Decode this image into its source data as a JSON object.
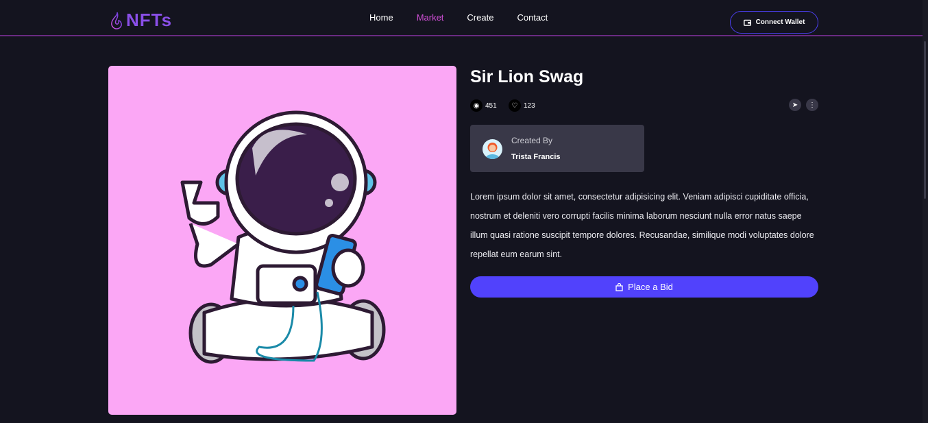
{
  "header": {
    "logo": "NFTs",
    "nav": [
      "Home",
      "Market",
      "Create",
      "Contact"
    ],
    "active_nav": "Market",
    "connect_wallet": "Connect Wallet"
  },
  "item": {
    "title": "Sir Lion Swag",
    "views": "451",
    "likes": "123",
    "created_by_label": "Created By",
    "creator": "Trista Francis",
    "description": "Lorem ipsum dolor sit amet, consectetur adipisicing elit. Veniam adipisci cupiditate officia, nostrum et deleniti vero corrupti facilis minima laborum nesciunt nulla error natus saepe illum quasi ratione suscipit tempore dolores. Recusandae, similique modi voluptates dolore repellat eum earum sint.",
    "bid_label": "Place a Bid"
  },
  "colors": {
    "accent": "#5142fc",
    "nav_active": "#d04fd6",
    "art_bg": "#fba7f5",
    "card": "#393848"
  }
}
